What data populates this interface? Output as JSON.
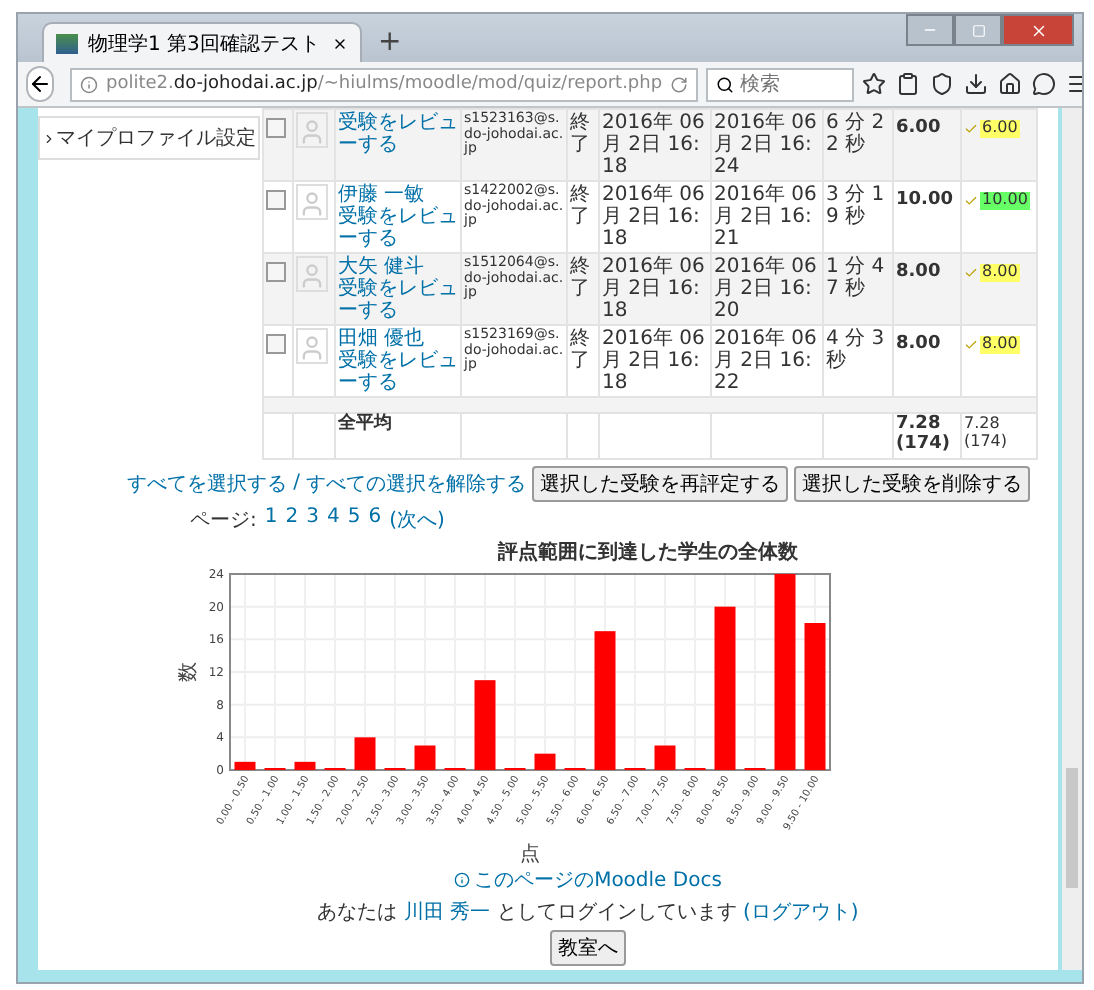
{
  "browser": {
    "tab_title": "物理学1  第3回確認テスト",
    "new_tab": "+",
    "url_host": "polite2.",
    "url_domain": "do-johodai.ac.jp",
    "url_path": "/~hiulms/moodle/mod/quiz/report.php",
    "search_placeholder": "検索"
  },
  "sidebar": {
    "items": [
      "マイプロファイル設定"
    ]
  },
  "attempts": {
    "rows": [
      {
        "checked": false,
        "name": "",
        "review": "受験をレビューする",
        "email": "s1523163@s.do-johodai.ac.jp",
        "status": "終了",
        "started": "2016年 06月 2日 16:18",
        "finished": "2016年 06月 2日 16:24",
        "time": "6 分 22 秒",
        "grade": "6.00",
        "q1": "6.00",
        "color": "#ffff66"
      },
      {
        "checked": false,
        "name": "伊藤 一敏",
        "review": "受験をレビューする",
        "email": "s1422002@s.do-johodai.ac.jp",
        "status": "終了",
        "started": "2016年 06月 2日 16:18",
        "finished": "2016年 06月 2日 16:21",
        "time": "3 分 19 秒",
        "grade": "10.00",
        "q1": "10.00",
        "color": "#66ff66"
      },
      {
        "checked": false,
        "name": "大矢 健斗",
        "review": "受験をレビューする",
        "email": "s1512064@s.do-johodai.ac.jp",
        "status": "終了",
        "started": "2016年 06月 2日 16:18",
        "finished": "2016年 06月 2日 16:20",
        "time": "1 分 47 秒",
        "grade": "8.00",
        "q1": "8.00",
        "color": "#ffff66"
      },
      {
        "checked": false,
        "name": "田畑 優也",
        "review": "受験をレビューする",
        "email": "s1523169@s.do-johodai.ac.jp",
        "status": "終了",
        "started": "2016年 06月 2日 16:18",
        "finished": "2016年 06月 2日 16:22",
        "time": "4 分 3 秒",
        "grade": "8.00",
        "q1": "8.00",
        "color": "#ffff66"
      }
    ],
    "average": {
      "label": "全平均",
      "grade": "7.28 (174)",
      "q1": "7.28 (174)"
    }
  },
  "bulk": {
    "select_all": "すべてを選択する",
    "separator": "/",
    "deselect_all": "すべての選択を解除する",
    "buttons": [
      "選択した受験を再評定する",
      "選択した受験を削除する"
    ]
  },
  "pager": {
    "label": "ページ:",
    "pages": [
      "1",
      "2",
      "3",
      "4",
      "5",
      "6"
    ],
    "next": "(次へ)"
  },
  "chart": {
    "chart_data": {
      "type": "bar",
      "title": "評点範囲に到達した学生の全体数",
      "xlabel": "点",
      "ylabel": "数",
      "grid": true,
      "categories": [
        "0.00 - 0.50",
        "0.50 - 1.00",
        "1.00 - 1.50",
        "1.50 - 2.00",
        "2.00 - 2.50",
        "2.50 - 3.00",
        "3.00 - 3.50",
        "3.50 - 4.00",
        "4.00 - 4.50",
        "4.50 - 5.00",
        "5.00 - 5.50",
        "5.50 - 6.00",
        "6.00 - 6.50",
        "6.50 - 7.00",
        "7.00 - 7.50",
        "7.50 - 8.00",
        "8.00 - 8.50",
        "8.50 - 9.00",
        "9.00 - 9.50",
        "9.50 - 10.00"
      ],
      "series": [
        {
          "color": "#ff0000",
          "values": [
            1,
            0,
            1,
            0,
            4,
            0,
            3,
            0,
            11,
            0,
            2,
            0,
            17,
            0,
            3,
            0,
            20,
            0,
            24,
            18
          ]
        }
      ],
      "ylim": [
        0,
        24
      ],
      "yticks": [
        0,
        4,
        8,
        12,
        16,
        20,
        24
      ]
    }
  },
  "footer": {
    "docs": "このページのMoodle Docs",
    "login_prefix": "あなたは",
    "user": "川田 秀一",
    "login_suffix": "としてログインしています",
    "logout": "(ログアウト)",
    "button": "教室へ"
  }
}
